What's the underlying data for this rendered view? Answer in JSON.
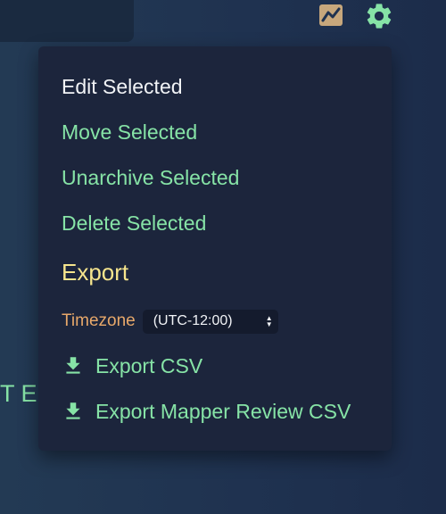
{
  "background": {
    "partial_text": "T E"
  },
  "header": {
    "icons": {
      "chart": "chart-icon",
      "settings": "gear-icon"
    }
  },
  "menu": {
    "items": [
      {
        "label": "Edit Selected"
      },
      {
        "label": "Move Selected"
      },
      {
        "label": "Unarchive Selected"
      },
      {
        "label": "Delete Selected"
      }
    ],
    "export": {
      "title": "Export",
      "timezone_label": "Timezone",
      "timezone_value": "(UTC-12:00)",
      "links": [
        {
          "label": "Export CSV",
          "icon": "download-icon"
        },
        {
          "label": "Export Mapper Review CSV",
          "icon": "download-icon"
        }
      ]
    }
  },
  "colors": {
    "menu_bg": "#1c253c",
    "accent_green": "#86e3a6",
    "section_yellow": "#f6e58d",
    "label_orange": "#e7a86a",
    "chart_icon_tan": "#c7a77c"
  }
}
